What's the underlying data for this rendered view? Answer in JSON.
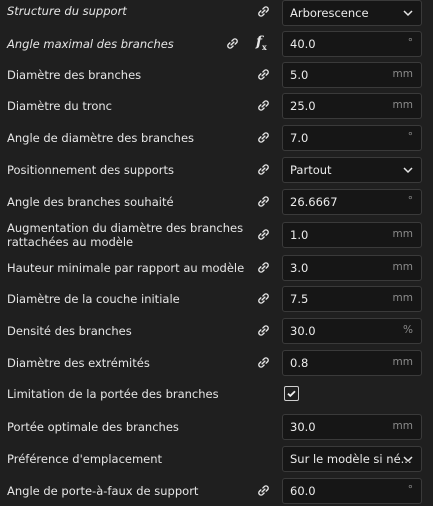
{
  "rows": [
    {
      "label": "Structure du support",
      "italic": true,
      "control": "select",
      "value": "Arborescence",
      "unit": ""
    },
    {
      "label": "Angle maximal des branches",
      "italic": true,
      "control": "input",
      "value": "40.0",
      "unit": "°"
    },
    {
      "label": "Diamètre des branches",
      "control": "input",
      "value": "5.0",
      "unit": "mm"
    },
    {
      "label": "Diamètre du tronc",
      "control": "input",
      "value": "25.0",
      "unit": "mm"
    },
    {
      "label": "Angle de diamètre des branches",
      "control": "input",
      "value": "7.0",
      "unit": "°"
    },
    {
      "label": "Positionnement des supports",
      "control": "select",
      "value": "Partout",
      "unit": ""
    },
    {
      "label": "Angle des branches souhaité",
      "control": "input",
      "value": "26.6667",
      "unit": "°"
    },
    {
      "label": "Augmentation du diamètre des branches rattachées au modèle",
      "control": "input",
      "value": "1.0",
      "unit": "mm"
    },
    {
      "label": "Hauteur minimale par rapport au modèle",
      "control": "input",
      "value": "3.0",
      "unit": "mm"
    },
    {
      "label": "Diamètre de la couche initiale",
      "control": "input",
      "value": "7.5",
      "unit": "mm"
    },
    {
      "label": "Densité des branches",
      "control": "input",
      "value": "30.0",
      "unit": "%"
    },
    {
      "label": "Diamètre des extrémités",
      "control": "input",
      "value": "0.8",
      "unit": "mm"
    },
    {
      "label": "Limitation de la portée des branches",
      "control": "checkbox",
      "checked": true
    },
    {
      "label": "Portée optimale des branches",
      "control": "input",
      "value": "30.0",
      "unit": "mm"
    },
    {
      "label": "Préférence d'emplacement",
      "control": "select",
      "value": "Sur le modèle si né...",
      "unit": ""
    },
    {
      "label": "Angle de porte-à-faux de support",
      "control": "input",
      "value": "60.0",
      "unit": "°"
    }
  ],
  "fx_label": "f",
  "fx_sub": "x",
  "icons": {
    "link": "link-icon",
    "formula": "formula-icon",
    "dropdown": "chevron-down-icon",
    "check": "checkmark-icon"
  },
  "colors": {
    "background": "#1f1f1f",
    "field_bg": "#161616",
    "text": "#e6e6e6",
    "unit": "#8a8a8a"
  }
}
